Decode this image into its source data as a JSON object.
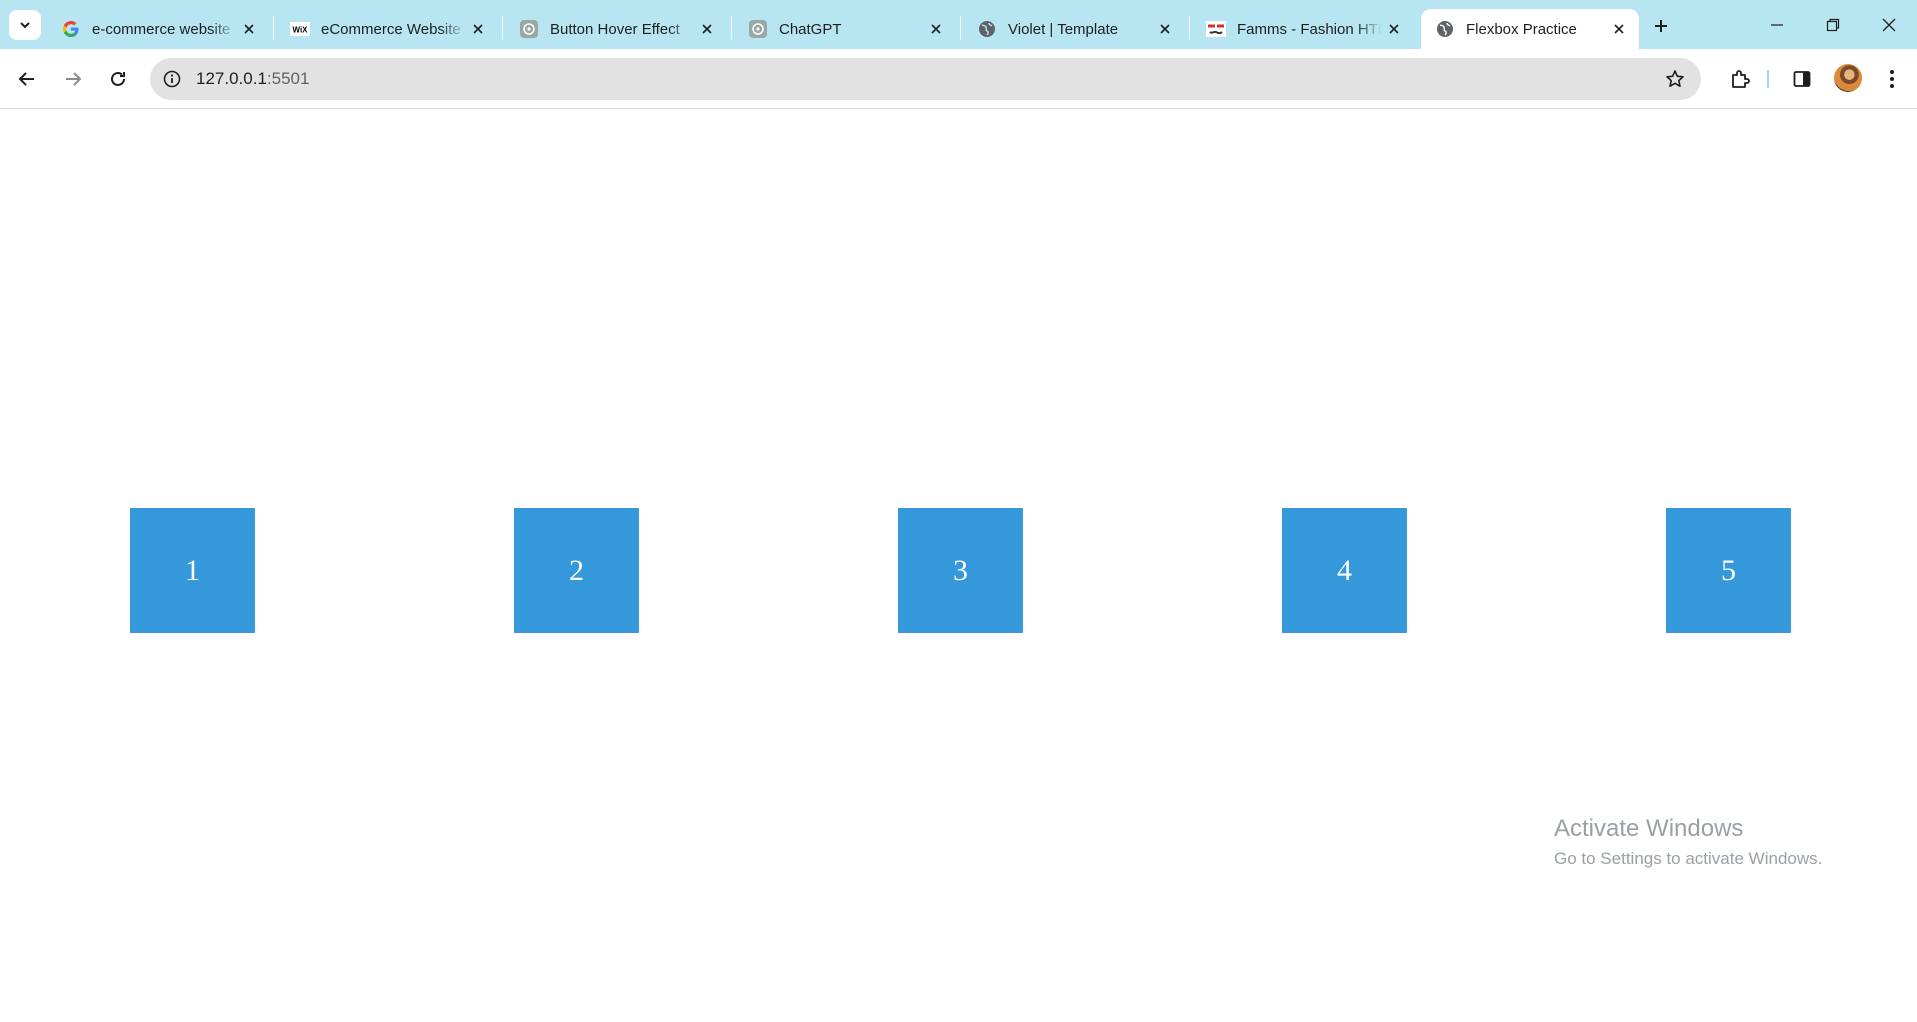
{
  "tabs": [
    {
      "title": "e-commerce website",
      "favicon": "google-icon",
      "active": false
    },
    {
      "title": "eCommerce Website",
      "favicon": "wix-icon",
      "active": false
    },
    {
      "title": "Button Hover Effect",
      "favicon": "chatgpt-icon",
      "active": false
    },
    {
      "title": "ChatGPT",
      "favicon": "chatgpt-icon",
      "active": false
    },
    {
      "title": "Violet | Template",
      "favicon": "globe-icon",
      "active": false
    },
    {
      "title": "Famms - Fashion HTML",
      "favicon": "famms-icon",
      "active": false
    },
    {
      "title": "Flexbox Practice",
      "favicon": "globe-icon",
      "active": true
    }
  ],
  "wix_label": "WiX",
  "address_bar": {
    "host": "127.0.0.1",
    "port": ":5501"
  },
  "page": {
    "boxes": [
      "1",
      "2",
      "3",
      "4",
      "5"
    ],
    "box_color": "#3498db"
  },
  "watermark": {
    "title": "Activate Windows",
    "subtitle": "Go to Settings to activate Windows."
  },
  "colors": {
    "tabstrip": "#b7e6f2",
    "omnibox": "#e2e2e2"
  }
}
